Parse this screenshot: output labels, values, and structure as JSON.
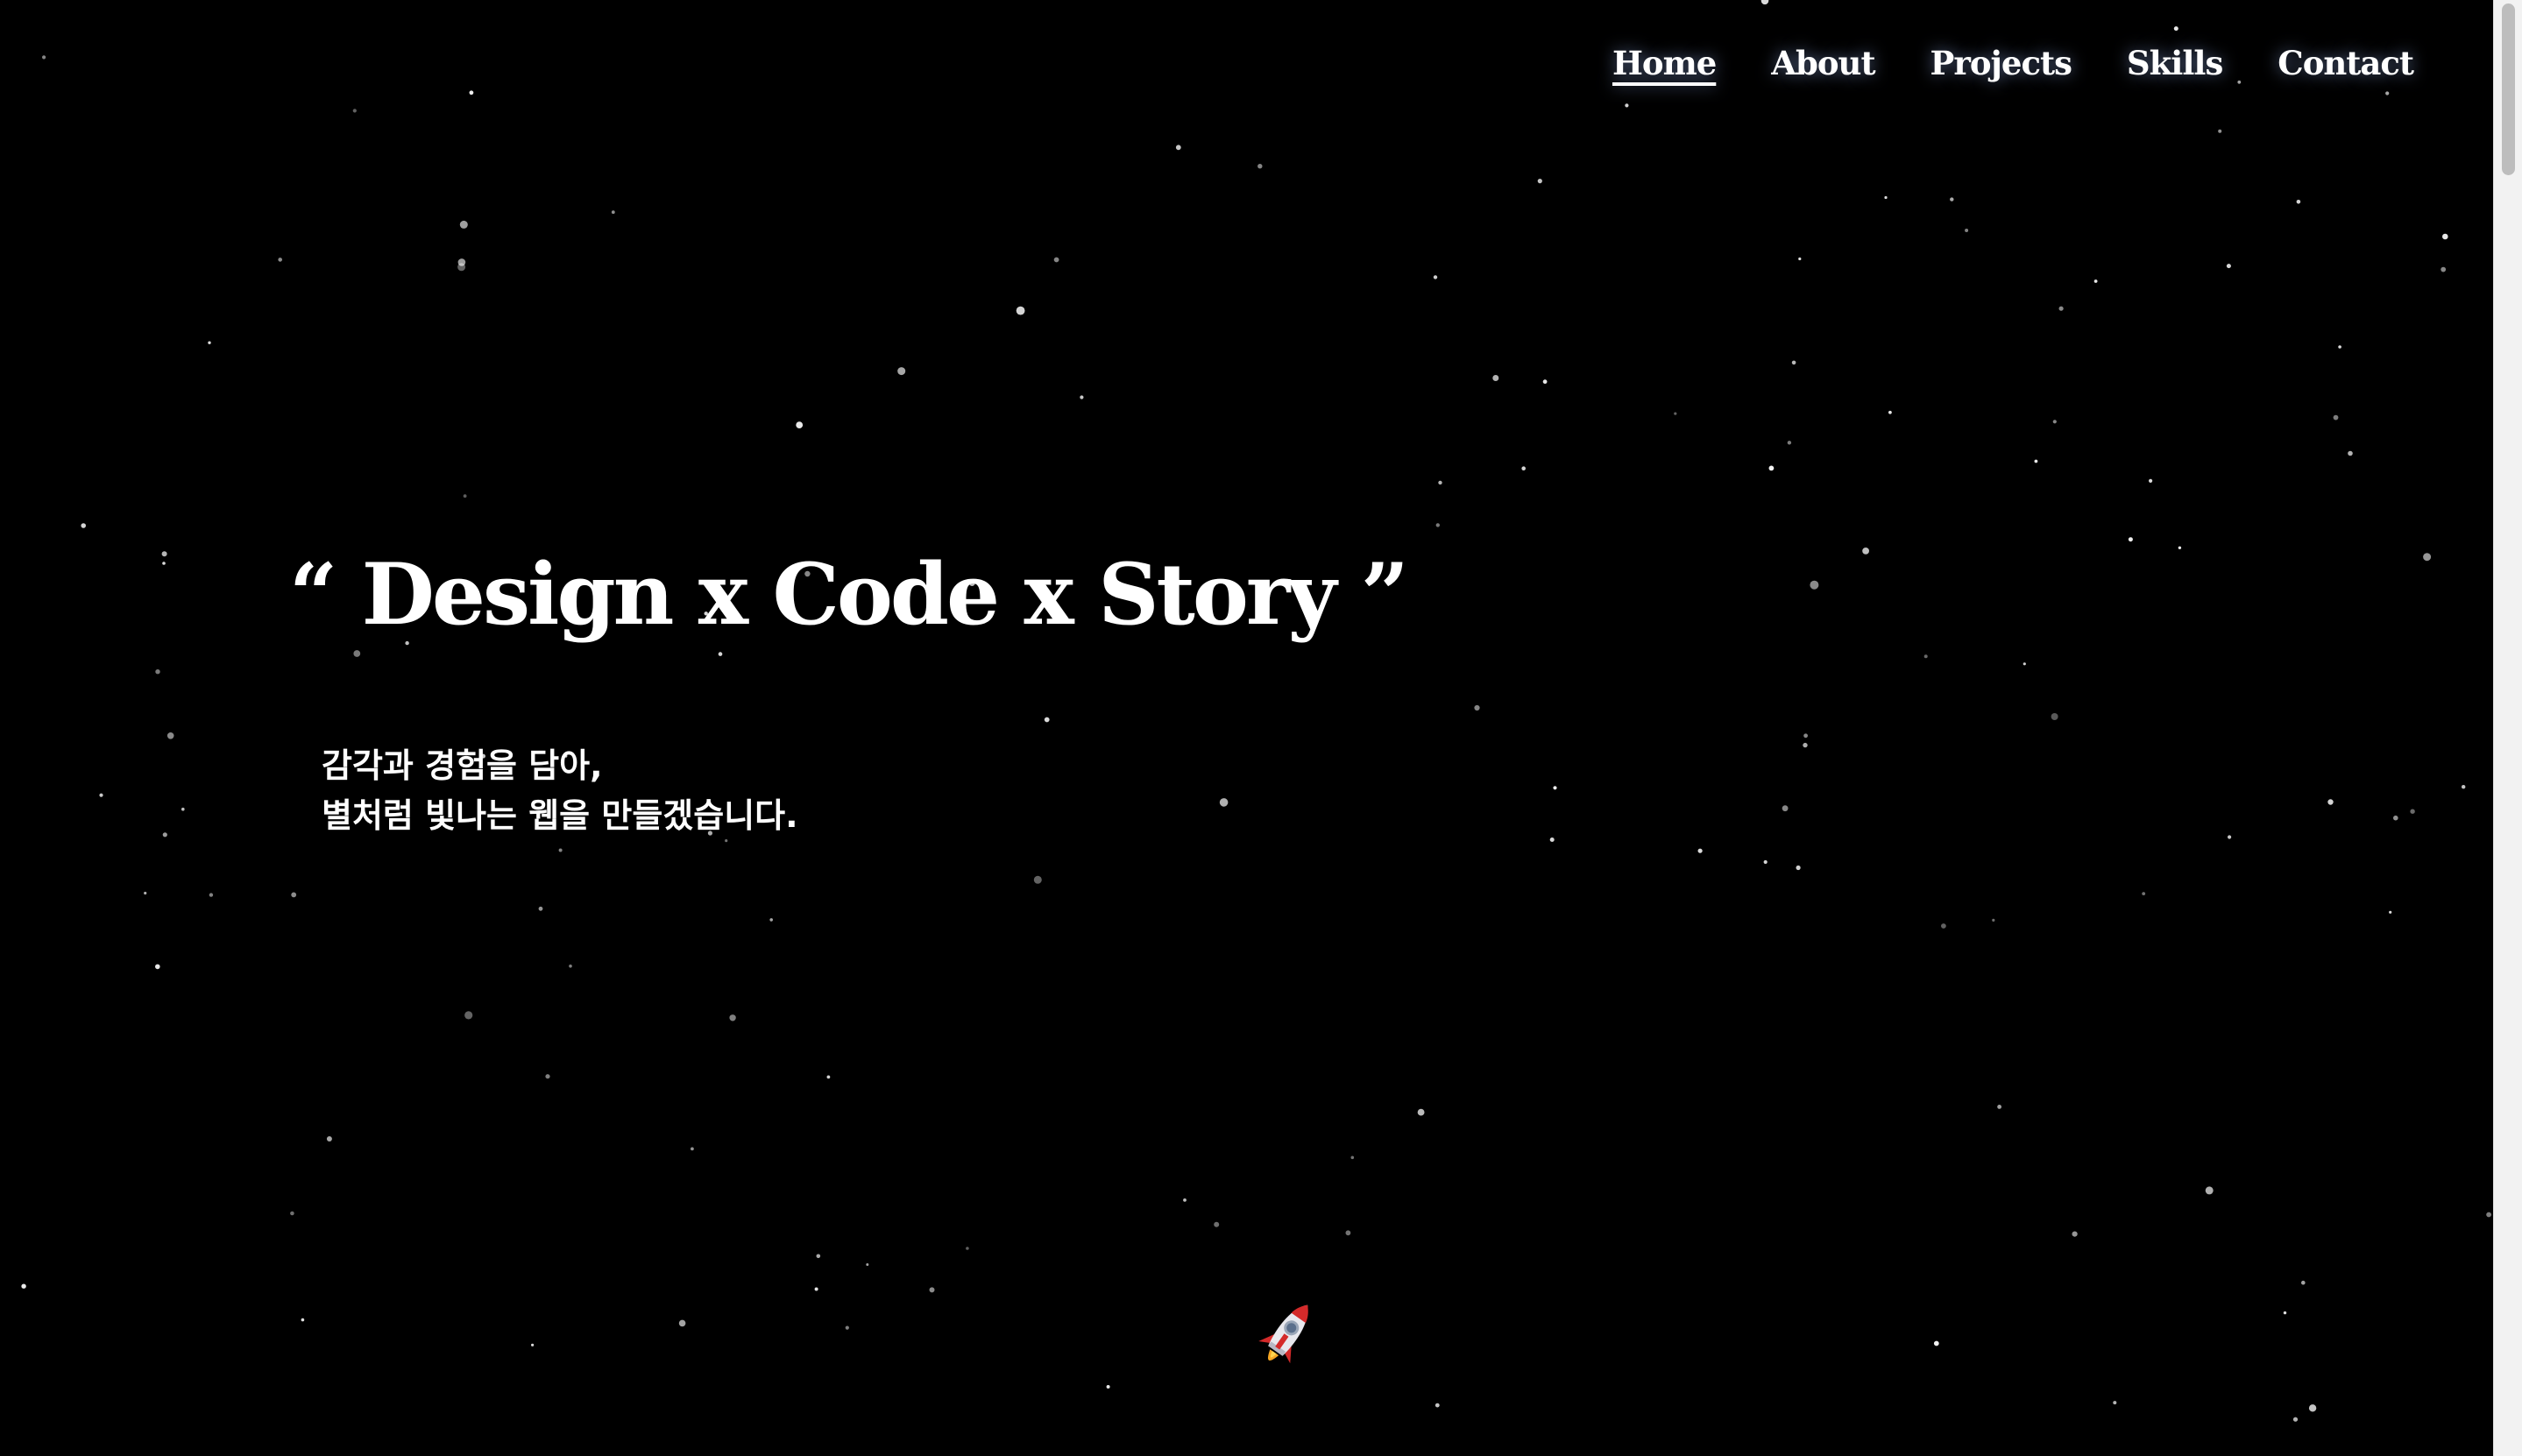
{
  "nav": {
    "items": [
      {
        "label": "Home",
        "active": true
      },
      {
        "label": "About",
        "active": false
      },
      {
        "label": "Projects",
        "active": false
      },
      {
        "label": "Skills",
        "active": false
      },
      {
        "label": "Contact",
        "active": false
      }
    ]
  },
  "hero": {
    "title": "“ Design x Code x Story ”",
    "subtitle_line1": "감각과 경험을 담아,",
    "subtitle_line2": "별처럼 빛나는 웹을 만들겠습니다."
  },
  "icons": {
    "rocket": "rocket-icon"
  },
  "colors": {
    "background": "#000000",
    "text": "#ffffff",
    "nav_glow": "#a0beff",
    "rocket_body": "#e8e8ee",
    "rocket_red": "#d42a2a"
  }
}
